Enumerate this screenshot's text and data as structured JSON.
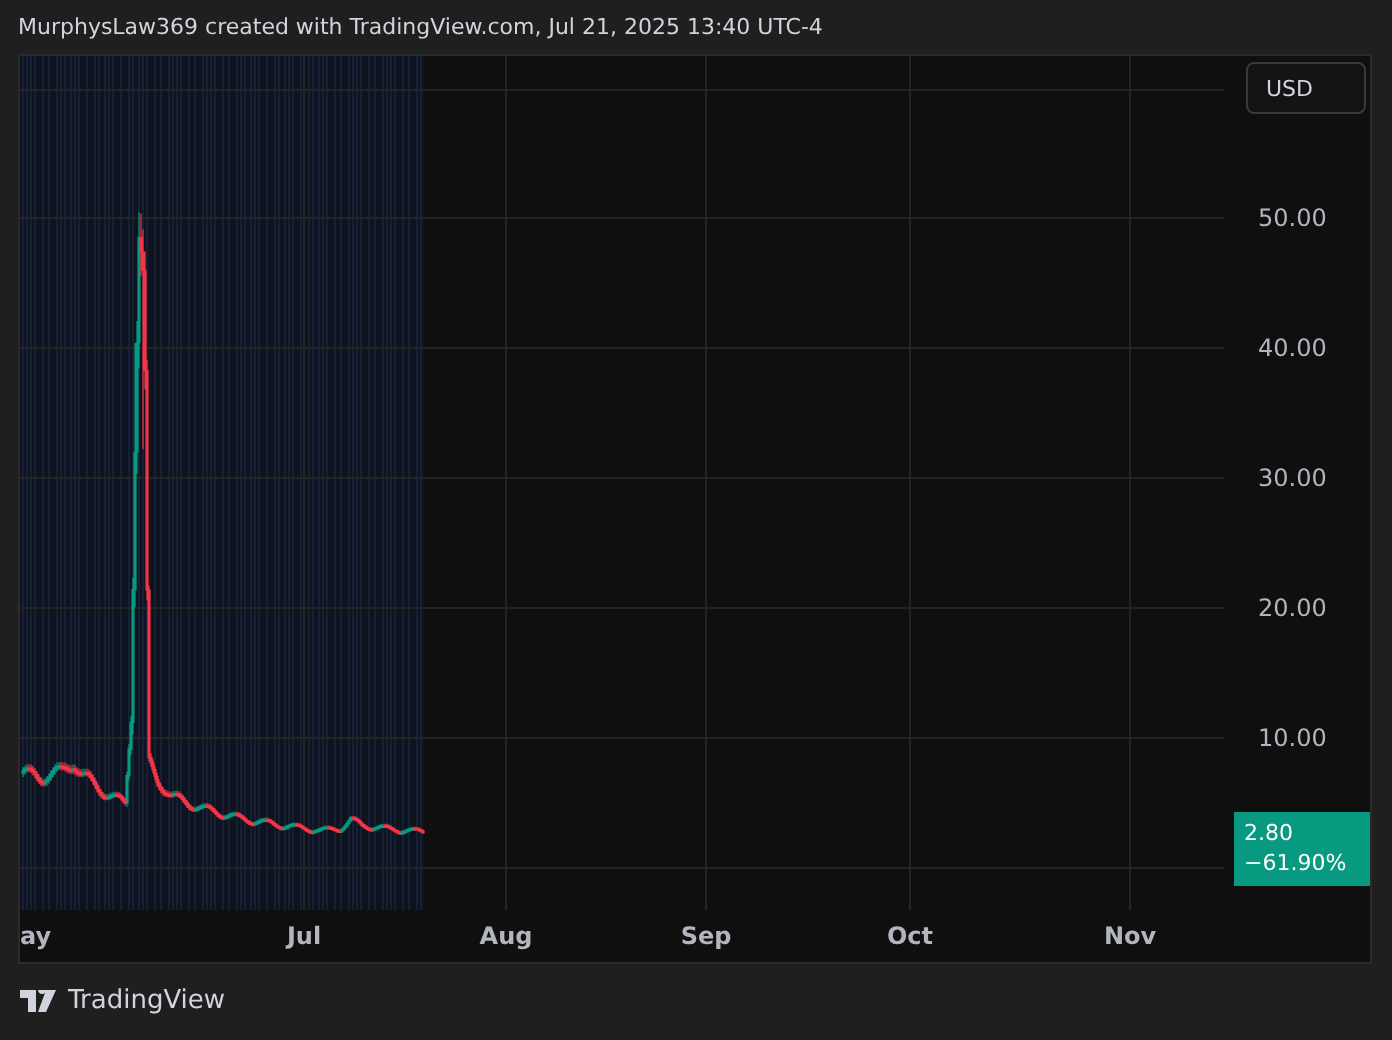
{
  "header": {
    "title": "MurphysLaw369 created with TradingView.com, Jul 21, 2025 13:40 UTC-4"
  },
  "currency_button": {
    "label": "USD"
  },
  "price_axis": {
    "labels": [
      "50.00",
      "40.00",
      "30.00",
      "20.00",
      "10.00"
    ]
  },
  "price_tag": {
    "price": "2.80",
    "change": "−61.90%"
  },
  "time_axis": {
    "labels": [
      {
        "text": "ay",
        "kind": "edge"
      },
      {
        "text": "Jul",
        "kind": "month"
      },
      {
        "text": "Aug",
        "kind": "month"
      },
      {
        "text": "Sep",
        "kind": "month"
      },
      {
        "text": "Oct",
        "kind": "month"
      },
      {
        "text": "Nov",
        "kind": "month"
      }
    ]
  },
  "footer": {
    "brand": "TradingView"
  }
}
